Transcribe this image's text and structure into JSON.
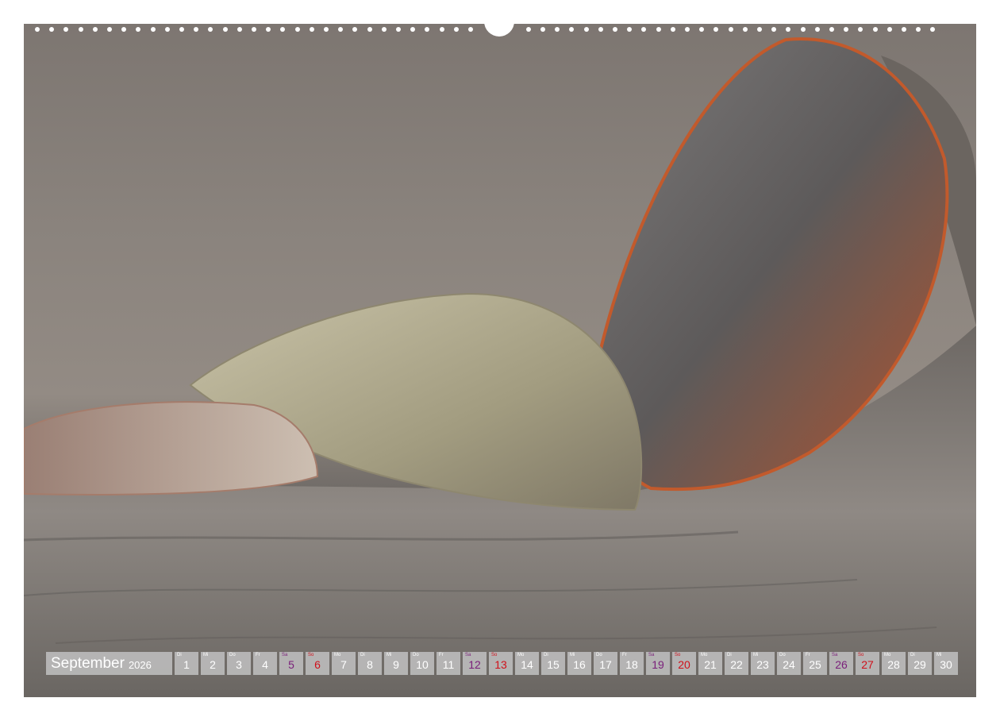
{
  "calendar": {
    "month": "September",
    "year": "2026",
    "days": [
      {
        "wd": "Di",
        "num": "1",
        "type": "weekday"
      },
      {
        "wd": "Mi",
        "num": "2",
        "type": "weekday"
      },
      {
        "wd": "Do",
        "num": "3",
        "type": "weekday"
      },
      {
        "wd": "Fr",
        "num": "4",
        "type": "weekday"
      },
      {
        "wd": "Sa",
        "num": "5",
        "type": "sat"
      },
      {
        "wd": "So",
        "num": "6",
        "type": "sun"
      },
      {
        "wd": "Mo",
        "num": "7",
        "type": "weekday"
      },
      {
        "wd": "Di",
        "num": "8",
        "type": "weekday"
      },
      {
        "wd": "Mi",
        "num": "9",
        "type": "weekday"
      },
      {
        "wd": "Do",
        "num": "10",
        "type": "weekday"
      },
      {
        "wd": "Fr",
        "num": "11",
        "type": "weekday"
      },
      {
        "wd": "Sa",
        "num": "12",
        "type": "sat"
      },
      {
        "wd": "So",
        "num": "13",
        "type": "sun"
      },
      {
        "wd": "Mo",
        "num": "14",
        "type": "weekday"
      },
      {
        "wd": "Di",
        "num": "15",
        "type": "weekday"
      },
      {
        "wd": "Mi",
        "num": "16",
        "type": "weekday"
      },
      {
        "wd": "Do",
        "num": "17",
        "type": "weekday"
      },
      {
        "wd": "Fr",
        "num": "18",
        "type": "weekday"
      },
      {
        "wd": "Sa",
        "num": "19",
        "type": "sat"
      },
      {
        "wd": "So",
        "num": "20",
        "type": "sun"
      },
      {
        "wd": "Mo",
        "num": "21",
        "type": "weekday"
      },
      {
        "wd": "Di",
        "num": "22",
        "type": "weekday"
      },
      {
        "wd": "Mi",
        "num": "23",
        "type": "weekday"
      },
      {
        "wd": "Do",
        "num": "24",
        "type": "weekday"
      },
      {
        "wd": "Fr",
        "num": "25",
        "type": "weekday"
      },
      {
        "wd": "Sa",
        "num": "26",
        "type": "sat"
      },
      {
        "wd": "So",
        "num": "27",
        "type": "sun"
      },
      {
        "wd": "Mo",
        "num": "28",
        "type": "weekday"
      },
      {
        "wd": "Di",
        "num": "29",
        "type": "weekday"
      },
      {
        "wd": "Mi",
        "num": "30",
        "type": "weekday"
      }
    ]
  },
  "colors": {
    "saturday": "#7a1f7a",
    "sunday": "#d0101a",
    "date_box": "#bebebe"
  }
}
